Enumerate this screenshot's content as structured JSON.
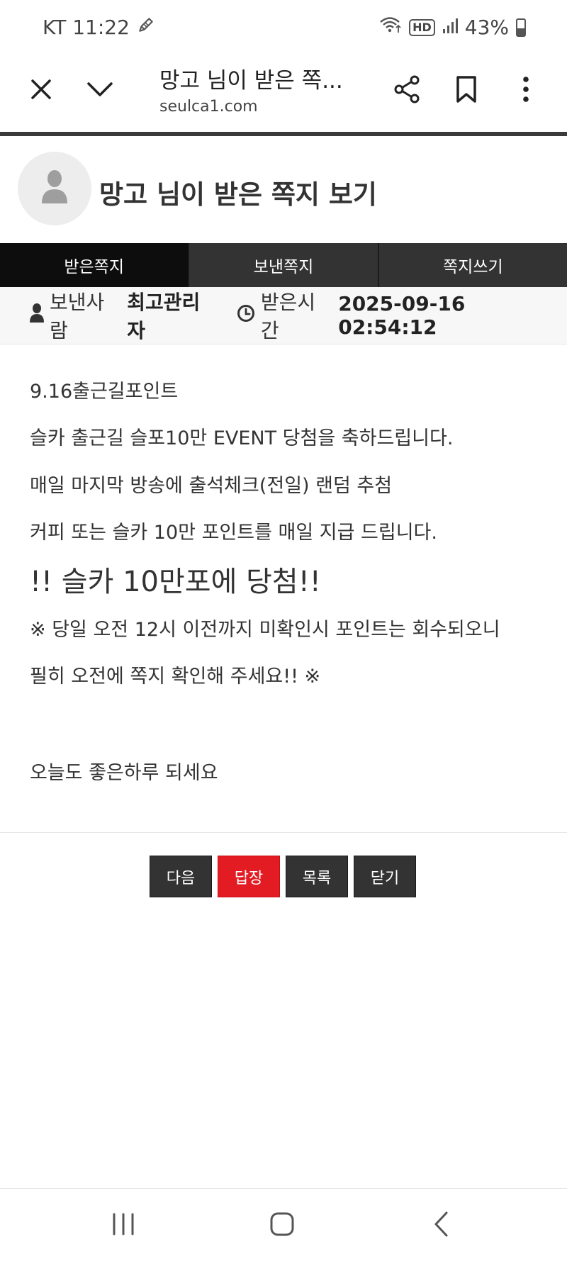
{
  "status_bar": {
    "carrier_time": "KT 11:22",
    "hd_badge": "HD",
    "battery": "43%",
    "battery_level": 0.43,
    "icons": [
      "pen-icon",
      "wifi-icon",
      "hd-voice-icon",
      "signal-icon",
      "battery-icon"
    ]
  },
  "browser": {
    "title": "망고 님이 받은 쪽...",
    "url": "seulca1.com",
    "icons": [
      "close-icon",
      "chevron-down-icon",
      "share-icon",
      "bookmark-icon",
      "more-vert-icon"
    ]
  },
  "page": {
    "title": "망고 님이 받은 쪽지 보기",
    "avatar_icon": "user-icon"
  },
  "tabs": [
    {
      "label": "받은쪽지",
      "active": true
    },
    {
      "label": "보낸쪽지",
      "active": false
    },
    {
      "label": "쪽지쓰기",
      "active": false
    }
  ],
  "meta": {
    "sender_label": "보낸사람",
    "sender_value": "최고관리자",
    "time_label": "받은시간",
    "time_value": "2025-09-16 02:54:12"
  },
  "message": {
    "lines": [
      "9.16출근길포인트",
      "슬카 출근길 슬포10만 EVENT 당첨을 축하드립니다.",
      "매일 마지막 방송에 출석체크(전일) 랜덤 추첨",
      "커피 또는 슬카 10만 포인트를 매일 지급 드립니다.",
      "!! 슬카 10만포에 당첨!!",
      "※ 당일 오전 12시 이전까지 미확인시 포인트는 회수되오니",
      "필히 오전에 쪽지 확인해 주세요!! ※",
      "오늘도 좋은하루 되세요"
    ]
  },
  "actions": {
    "next": "다음",
    "reply": "답장",
    "list": "목록",
    "close": "닫기"
  },
  "colors": {
    "accent_red": "#e31b23",
    "tab_dark": "#333333",
    "tab_active": "#0d0d0d"
  },
  "navbar": {
    "icons": [
      "recent-apps-icon",
      "home-icon",
      "back-icon"
    ]
  }
}
